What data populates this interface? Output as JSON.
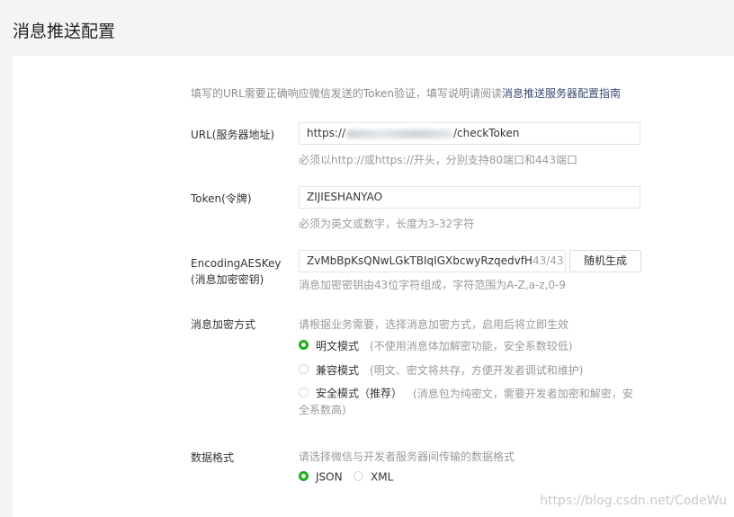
{
  "page_title": "消息推送配置",
  "intro": {
    "text": "填写的URL需要正确响应微信发送的Token验证，填写说明请阅读",
    "link": "消息推送服务器配置指南"
  },
  "url": {
    "label": "URL(服务器地址)",
    "value_prefix": "https://",
    "value_suffix": "/checkToken",
    "hint": "必须以http://或https://开头，分别支持80端口和443端口"
  },
  "token": {
    "label": "Token(令牌)",
    "value": "ZIJIESHANYAO",
    "hint": "必须为英文或数字，长度为3-32字符"
  },
  "aes": {
    "label_line1": "EncodingAESKey",
    "label_line2": "(消息加密密钥)",
    "value": "ZvMbBpKsQNwLGkTBIqIGXbcwyRzqedvfH",
    "counter": "43/43",
    "button": "随机生成",
    "hint": "消息加密密钥由43位字符组成，字符范围为A-Z,a-z,0-9"
  },
  "encryption": {
    "label": "消息加密方式",
    "hint": "请根据业务需要，选择消息加密方式，启用后将立即生效",
    "options": [
      {
        "label": "明文模式",
        "desc": "(不使用消息体加解密功能，安全系数较低)",
        "checked": true
      },
      {
        "label": "兼容模式",
        "desc": "(明文、密文将共存，方便开发者调试和维护)",
        "checked": false
      },
      {
        "label": "安全模式（推荐）",
        "desc": "(消息包为纯密文，需要开发者加密和解密，安全系数高)",
        "checked": false
      }
    ]
  },
  "data_format": {
    "label": "数据格式",
    "hint": "请选择微信与开发者服务器间传输的数据格式",
    "options": [
      {
        "label": "JSON",
        "checked": true
      },
      {
        "label": "XML",
        "checked": false
      }
    ]
  },
  "watermark": "https://blog.csdn.net/CodeWu"
}
